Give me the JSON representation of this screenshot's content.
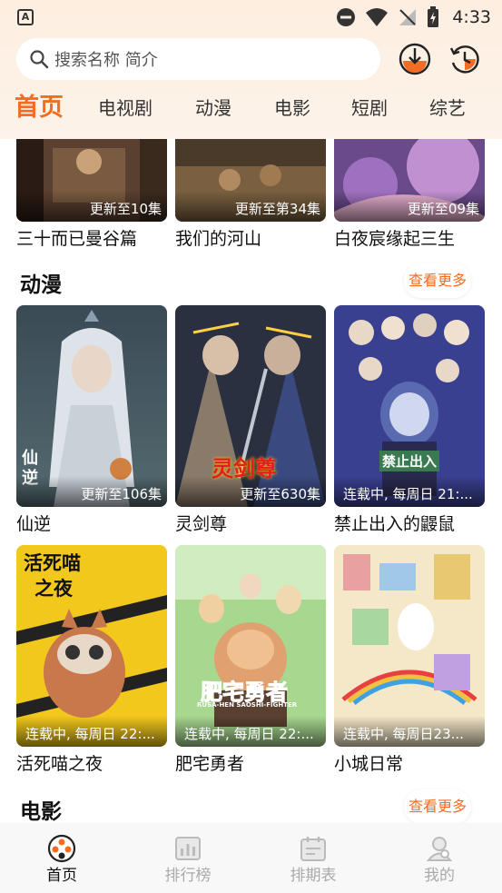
{
  "status_bar": {
    "time": "4:33",
    "notification_icon": "A"
  },
  "search": {
    "placeholder": "搜索名称 简介"
  },
  "header_buttons": [
    "download-icon",
    "history-icon"
  ],
  "tabs": [
    {
      "label": "首页",
      "active": true
    },
    {
      "label": "电视剧"
    },
    {
      "label": "动漫"
    },
    {
      "label": "电影"
    },
    {
      "label": "短剧"
    },
    {
      "label": "综艺"
    }
  ],
  "top_row": [
    {
      "title": "三十而已曼谷篇",
      "badge": "更新至10集"
    },
    {
      "title": "我们的河山",
      "badge": "更新至第34集"
    },
    {
      "title": "白夜宸缘起三生",
      "badge": "更新至09集"
    }
  ],
  "anime": {
    "section_title": "动漫",
    "more_label": "查看更多",
    "items": [
      {
        "title": "仙逆",
        "badge": "更新至106集"
      },
      {
        "title": "灵剑尊",
        "badge": "更新至630集"
      },
      {
        "title": "禁止出入的鼹鼠",
        "badge": "连载中, 每周日 21:..."
      },
      {
        "title": "活死喵之夜",
        "badge": "连载中, 每周日 22:..."
      },
      {
        "title": "肥宅勇者",
        "badge": "连载中, 每周日 22:..."
      },
      {
        "title": "小城日常",
        "badge": "连载中, 每周日23..."
      }
    ]
  },
  "movies": {
    "section_title": "电影",
    "more_label": "查看更多"
  },
  "poster_text": {
    "cat_title_line1": "活死喵",
    "cat_title_line2": "之夜",
    "hero_logo": "肥宅勇者",
    "hero_sub": "RUSA-HEN SAOSHI-FIGHTER",
    "mole_logo": "禁止出入",
    "sword_logo": "灵剑尊",
    "xian_logo": "仙逆"
  },
  "bottom_nav": [
    {
      "label": "首页",
      "icon": "home-film-reel-icon",
      "active": true
    },
    {
      "label": "排行榜",
      "icon": "ranking-chart-icon"
    },
    {
      "label": "排期表",
      "icon": "calendar-icon"
    },
    {
      "label": "我的",
      "icon": "profile-icon"
    }
  ],
  "colors": {
    "accent": "#f26d21",
    "header_bg": "#fdeee0"
  }
}
